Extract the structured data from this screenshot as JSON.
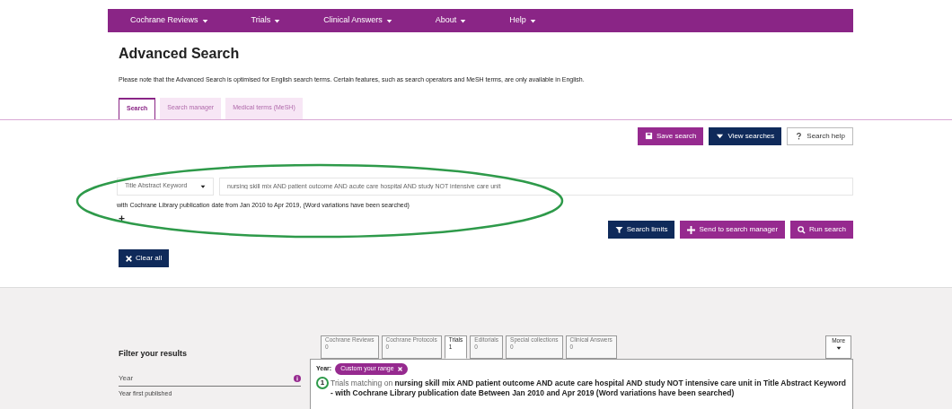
{
  "nav": [
    {
      "label": "Cochrane Reviews"
    },
    {
      "label": "Trials"
    },
    {
      "label": "Clinical Answers"
    },
    {
      "label": "About"
    },
    {
      "label": "Help"
    }
  ],
  "title": "Advanced Search",
  "note": "Please note that the Advanced Search is optimised for English search terms. Certain features, such as search operators and MeSH terms, are only available in English.",
  "tabs": [
    {
      "label": "Search",
      "selected": true
    },
    {
      "label": "Search manager",
      "selected": false
    },
    {
      "label": "Medical terms (MeSH)",
      "selected": false
    }
  ],
  "top_buttons": [
    {
      "label": "Save search",
      "kind": "primary"
    },
    {
      "label": "View searches",
      "kind": "dark"
    },
    {
      "label": "Search help",
      "kind": "outline"
    }
  ],
  "search_row": {
    "field": "Title Abstract Keyword",
    "value": "nursing skill mix AND patient outcome AND acute care hospital AND study NOT intensive care unit"
  },
  "limits_text": "with Cochrane Library publication date from Jan 2010 to Apr 2019, (Word variations have been searched)",
  "add_label": "+",
  "action_buttons": [
    {
      "label": "Search limits",
      "kind": "dark"
    },
    {
      "label": "Send to search manager",
      "kind": "primary"
    },
    {
      "label": "Run search",
      "kind": "primary"
    }
  ],
  "clear_button": "Clear all",
  "filter": {
    "title": "Filter your results",
    "label": "Year",
    "sub": "Year first published"
  },
  "result_tabs": [
    {
      "label": "Cochrane Reviews",
      "count": "0",
      "selected": false
    },
    {
      "label": "Cochrane Protocols",
      "count": "0",
      "selected": false
    },
    {
      "label": "Trials",
      "count": "1",
      "selected": true
    },
    {
      "label": "Editorials",
      "count": "0",
      "selected": false
    },
    {
      "label": "Special collections",
      "count": "0",
      "selected": false
    },
    {
      "label": "Clinical Answers",
      "count": "0",
      "selected": false
    }
  ],
  "more_tab": "More",
  "year_filter": {
    "label": "Year:",
    "chip": "Custom your range"
  },
  "result_count": "1",
  "result_text": "Trials matching on **nursing skill mix AND patient outcome AND acute care hospital AND study NOT intensive care unit in Title Abstract Keyword - with Cochrane Library publication date Between Jan 2010 and Apr 2019 (Word variations have been searched)**"
}
